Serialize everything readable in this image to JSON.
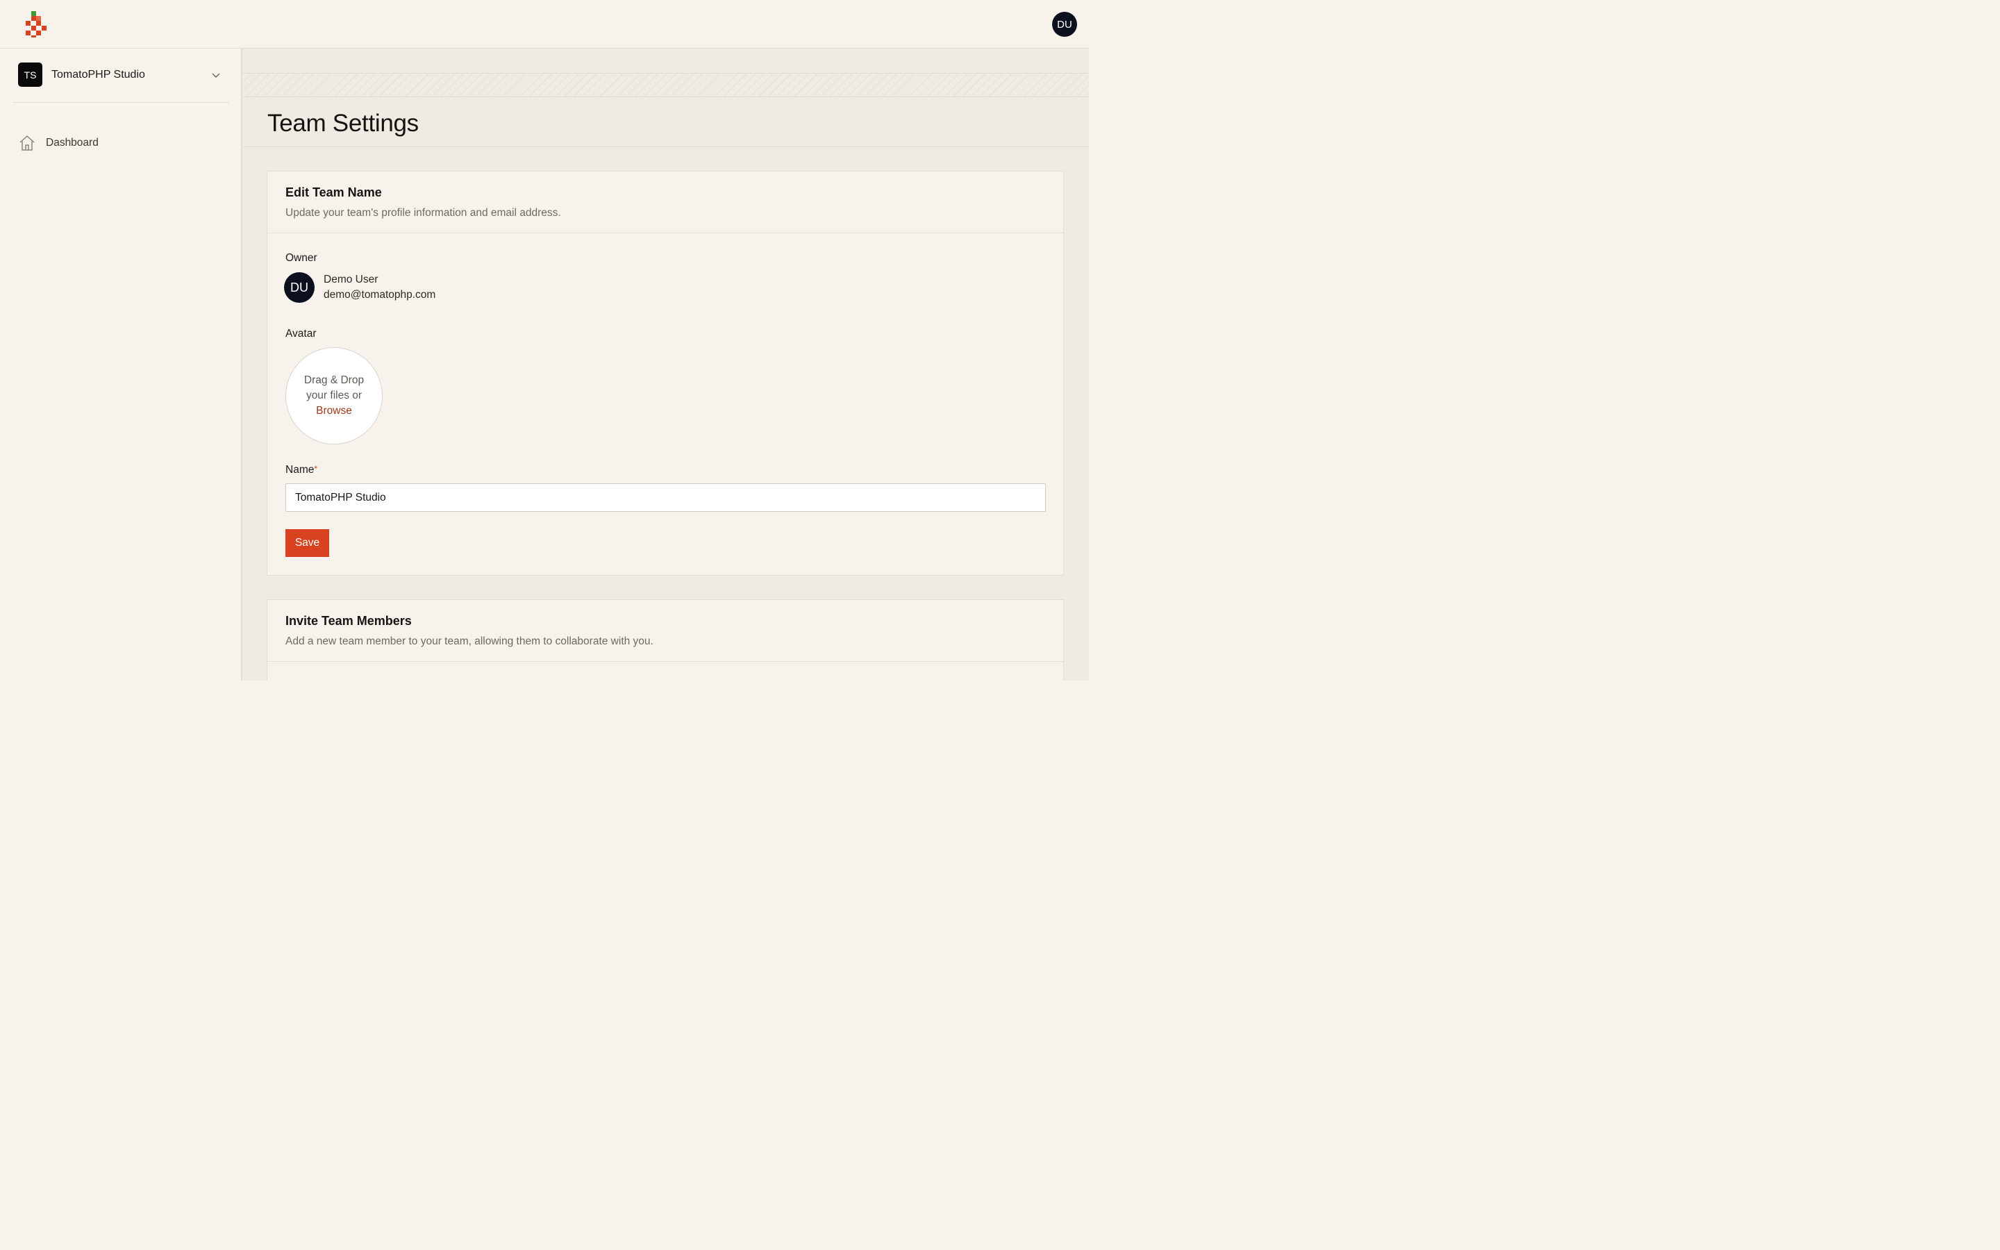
{
  "app": {
    "logo_icon": "tomato-logo-icon",
    "user_initials": "DU",
    "colors": {
      "accent": "#d9421f",
      "link": "#a4371b",
      "avatar_bg": "#0b0f1e",
      "leaf": "#3f9a3b"
    }
  },
  "sidebar": {
    "team": {
      "initials": "TS",
      "name": "TomatoPHP Studio",
      "icon": "chevron-down-icon"
    },
    "items": [
      {
        "label": "Dashboard",
        "icon": "home-icon"
      }
    ]
  },
  "page": {
    "title": "Team Settings"
  },
  "edit_team": {
    "title": "Edit Team Name",
    "description": "Update your team's profile information and email address.",
    "owner_label": "Owner",
    "owner": {
      "initials": "DU",
      "name": "Demo User",
      "email": "demo@tomatophp.com"
    },
    "avatar_label": "Avatar",
    "dropzone": {
      "line1": "Drag & Drop",
      "line2": "your files or",
      "browse": "Browse"
    },
    "name_label": "Name",
    "required_mark": "*",
    "name_value": "TomatoPHP Studio",
    "save_label": "Save"
  },
  "invite": {
    "title": "Invite Team Members",
    "description": "Add a new team member to your team, allowing them to collaborate with you."
  }
}
